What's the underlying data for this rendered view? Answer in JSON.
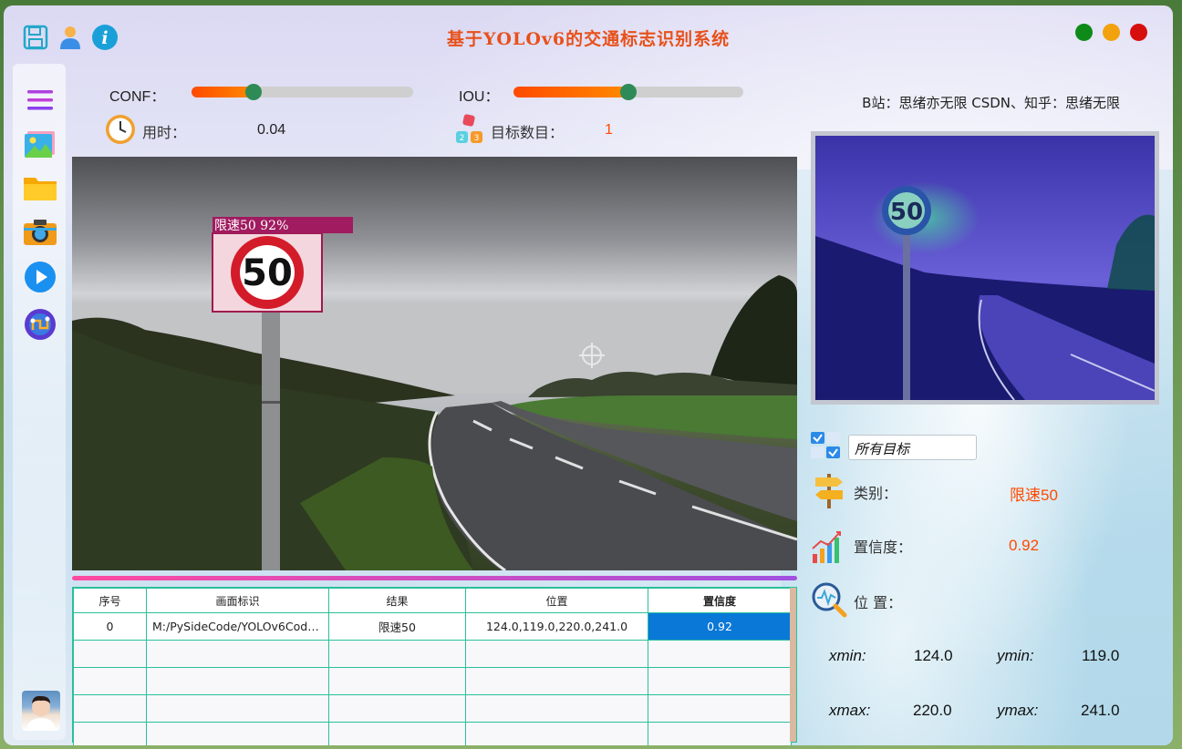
{
  "app": {
    "title": "基于YOLOv6的交通标志识别系统",
    "social": "B站：思绪亦无限  CSDN、知乎：思绪无限",
    "window_controls": [
      "green-dot",
      "orange-dot",
      "red-dot"
    ]
  },
  "top_icons": [
    "save-icon",
    "user-icon",
    "info-icon"
  ],
  "sidebar": {
    "items": [
      "menu-icon",
      "image-icon",
      "folder-icon",
      "camera-icon",
      "play-icon",
      "model-icon"
    ]
  },
  "params": {
    "conf_label": "CONF：",
    "conf_value": 0.28,
    "iou_label": "IOU：",
    "iou_value": 0.5,
    "time_label": "用时：",
    "time_value": "0.04",
    "count_label": "目标数目：",
    "count_value": "1"
  },
  "detection": {
    "box_label": "限速50  92%",
    "sign_text": "50"
  },
  "table": {
    "headers": [
      "序号",
      "画面标识",
      "结果",
      "位置",
      "置信度"
    ],
    "rows": [
      [
        "0",
        "M:/PySideCode/YOLOv6Code/...",
        "限速50",
        "124.0,119.0,220.0,241.0",
        "0.92"
      ]
    ],
    "empty_rows": 4
  },
  "panel": {
    "filter_value": "所有目标",
    "class_label": "类别：",
    "class_value": "限速50",
    "conf_label": "置信度：",
    "conf_value": "0.92",
    "pos_label": "位 置：",
    "xmin_label": "xmin:",
    "xmin_value": "124.0",
    "ymin_label": "ymin:",
    "ymin_value": "119.0",
    "xmax_label": "xmax:",
    "xmax_value": "220.0",
    "ymax_label": "ymax:",
    "ymax_value": "241.0"
  },
  "colors": {
    "accent": "#e8501a",
    "value_orange": "#ff4a00",
    "table_border": "#2bbf9a",
    "selected_cell": "#0a78d7",
    "slider_handle": "#2e8b57"
  }
}
